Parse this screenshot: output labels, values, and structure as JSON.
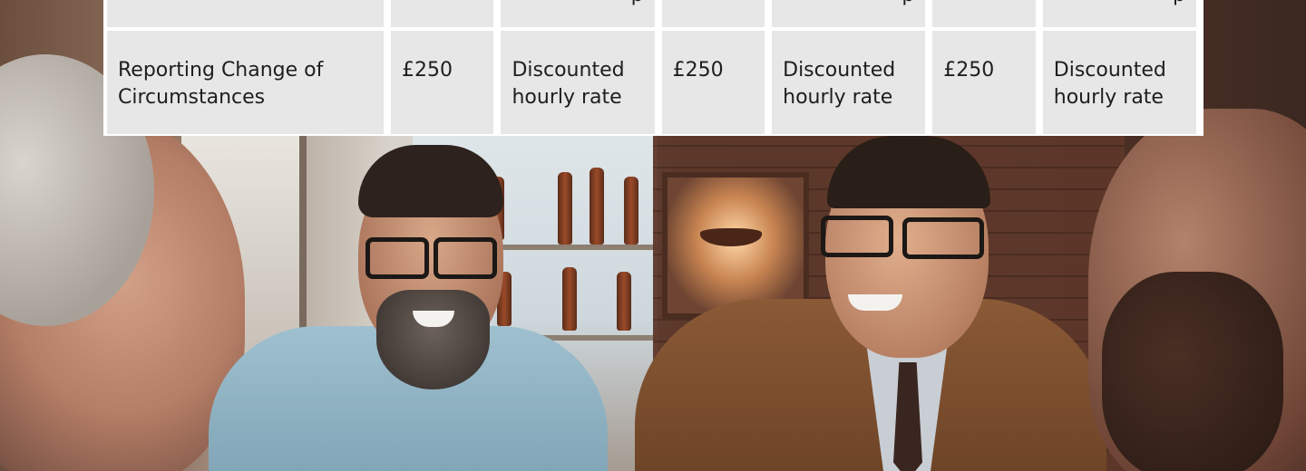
{
  "table": {
    "partial_top_row": {
      "c1": "",
      "c2": "",
      "c3": "p",
      "c4": "",
      "c5": "p",
      "c6": "",
      "c7": "p"
    },
    "rows": [
      {
        "service": "Reporting Change of Circumstances",
        "plan_a_price": "£250",
        "plan_a_hourly": "Discounted hourly rate",
        "plan_b_price": "£250",
        "plan_b_hourly": "Discounted hourly rate",
        "plan_c_price": "£250",
        "plan_c_hourly": "Discounted hourly rate"
      }
    ]
  },
  "photo": {
    "alt": "Four men laughing together around a table in a bar"
  },
  "colors": {
    "cell_background": "#e7e7e7",
    "table_border": "#ffffff",
    "text": "#1e1e1e"
  }
}
